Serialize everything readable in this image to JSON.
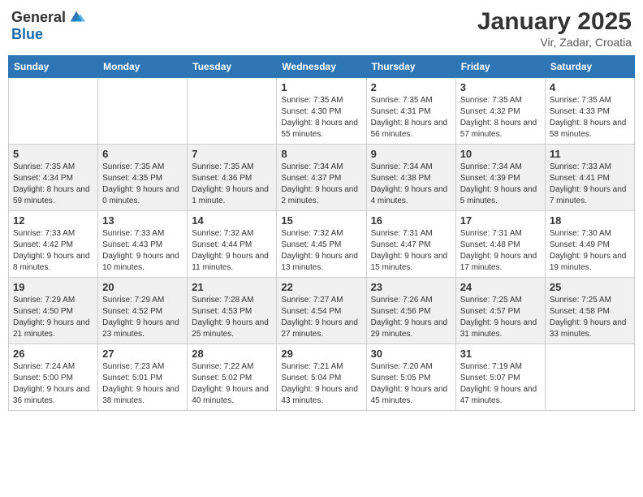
{
  "header": {
    "logo_general": "General",
    "logo_blue": "Blue",
    "month_year": "January 2025",
    "location": "Vir, Zadar, Croatia"
  },
  "weekdays": [
    "Sunday",
    "Monday",
    "Tuesday",
    "Wednesday",
    "Thursday",
    "Friday",
    "Saturday"
  ],
  "weeks": [
    [
      {
        "day": "",
        "info": ""
      },
      {
        "day": "",
        "info": ""
      },
      {
        "day": "",
        "info": ""
      },
      {
        "day": "1",
        "info": "Sunrise: 7:35 AM\nSunset: 4:30 PM\nDaylight: 8 hours\nand 55 minutes."
      },
      {
        "day": "2",
        "info": "Sunrise: 7:35 AM\nSunset: 4:31 PM\nDaylight: 8 hours\nand 56 minutes."
      },
      {
        "day": "3",
        "info": "Sunrise: 7:35 AM\nSunset: 4:32 PM\nDaylight: 8 hours\nand 57 minutes."
      },
      {
        "day": "4",
        "info": "Sunrise: 7:35 AM\nSunset: 4:33 PM\nDaylight: 8 hours\nand 58 minutes."
      }
    ],
    [
      {
        "day": "5",
        "info": "Sunrise: 7:35 AM\nSunset: 4:34 PM\nDaylight: 8 hours\nand 59 minutes."
      },
      {
        "day": "6",
        "info": "Sunrise: 7:35 AM\nSunset: 4:35 PM\nDaylight: 9 hours\nand 0 minutes."
      },
      {
        "day": "7",
        "info": "Sunrise: 7:35 AM\nSunset: 4:36 PM\nDaylight: 9 hours\nand 1 minute."
      },
      {
        "day": "8",
        "info": "Sunrise: 7:34 AM\nSunset: 4:37 PM\nDaylight: 9 hours\nand 2 minutes."
      },
      {
        "day": "9",
        "info": "Sunrise: 7:34 AM\nSunset: 4:38 PM\nDaylight: 9 hours\nand 4 minutes."
      },
      {
        "day": "10",
        "info": "Sunrise: 7:34 AM\nSunset: 4:39 PM\nDaylight: 9 hours\nand 5 minutes."
      },
      {
        "day": "11",
        "info": "Sunrise: 7:33 AM\nSunset: 4:41 PM\nDaylight: 9 hours\nand 7 minutes."
      }
    ],
    [
      {
        "day": "12",
        "info": "Sunrise: 7:33 AM\nSunset: 4:42 PM\nDaylight: 9 hours\nand 8 minutes."
      },
      {
        "day": "13",
        "info": "Sunrise: 7:33 AM\nSunset: 4:43 PM\nDaylight: 9 hours\nand 10 minutes."
      },
      {
        "day": "14",
        "info": "Sunrise: 7:32 AM\nSunset: 4:44 PM\nDaylight: 9 hours\nand 11 minutes."
      },
      {
        "day": "15",
        "info": "Sunrise: 7:32 AM\nSunset: 4:45 PM\nDaylight: 9 hours\nand 13 minutes."
      },
      {
        "day": "16",
        "info": "Sunrise: 7:31 AM\nSunset: 4:47 PM\nDaylight: 9 hours\nand 15 minutes."
      },
      {
        "day": "17",
        "info": "Sunrise: 7:31 AM\nSunset: 4:48 PM\nDaylight: 9 hours\nand 17 minutes."
      },
      {
        "day": "18",
        "info": "Sunrise: 7:30 AM\nSunset: 4:49 PM\nDaylight: 9 hours\nand 19 minutes."
      }
    ],
    [
      {
        "day": "19",
        "info": "Sunrise: 7:29 AM\nSunset: 4:50 PM\nDaylight: 9 hours\nand 21 minutes."
      },
      {
        "day": "20",
        "info": "Sunrise: 7:29 AM\nSunset: 4:52 PM\nDaylight: 9 hours\nand 23 minutes."
      },
      {
        "day": "21",
        "info": "Sunrise: 7:28 AM\nSunset: 4:53 PM\nDaylight: 9 hours\nand 25 minutes."
      },
      {
        "day": "22",
        "info": "Sunrise: 7:27 AM\nSunset: 4:54 PM\nDaylight: 9 hours\nand 27 minutes."
      },
      {
        "day": "23",
        "info": "Sunrise: 7:26 AM\nSunset: 4:56 PM\nDaylight: 9 hours\nand 29 minutes."
      },
      {
        "day": "24",
        "info": "Sunrise: 7:25 AM\nSunset: 4:57 PM\nDaylight: 9 hours\nand 31 minutes."
      },
      {
        "day": "25",
        "info": "Sunrise: 7:25 AM\nSunset: 4:58 PM\nDaylight: 9 hours\nand 33 minutes."
      }
    ],
    [
      {
        "day": "26",
        "info": "Sunrise: 7:24 AM\nSunset: 5:00 PM\nDaylight: 9 hours\nand 36 minutes."
      },
      {
        "day": "27",
        "info": "Sunrise: 7:23 AM\nSunset: 5:01 PM\nDaylight: 9 hours\nand 38 minutes."
      },
      {
        "day": "28",
        "info": "Sunrise: 7:22 AM\nSunset: 5:02 PM\nDaylight: 9 hours\nand 40 minutes."
      },
      {
        "day": "29",
        "info": "Sunrise: 7:21 AM\nSunset: 5:04 PM\nDaylight: 9 hours\nand 43 minutes."
      },
      {
        "day": "30",
        "info": "Sunrise: 7:20 AM\nSunset: 5:05 PM\nDaylight: 9 hours\nand 45 minutes."
      },
      {
        "day": "31",
        "info": "Sunrise: 7:19 AM\nSunset: 5:07 PM\nDaylight: 9 hours\nand 47 minutes."
      },
      {
        "day": "",
        "info": ""
      }
    ]
  ]
}
